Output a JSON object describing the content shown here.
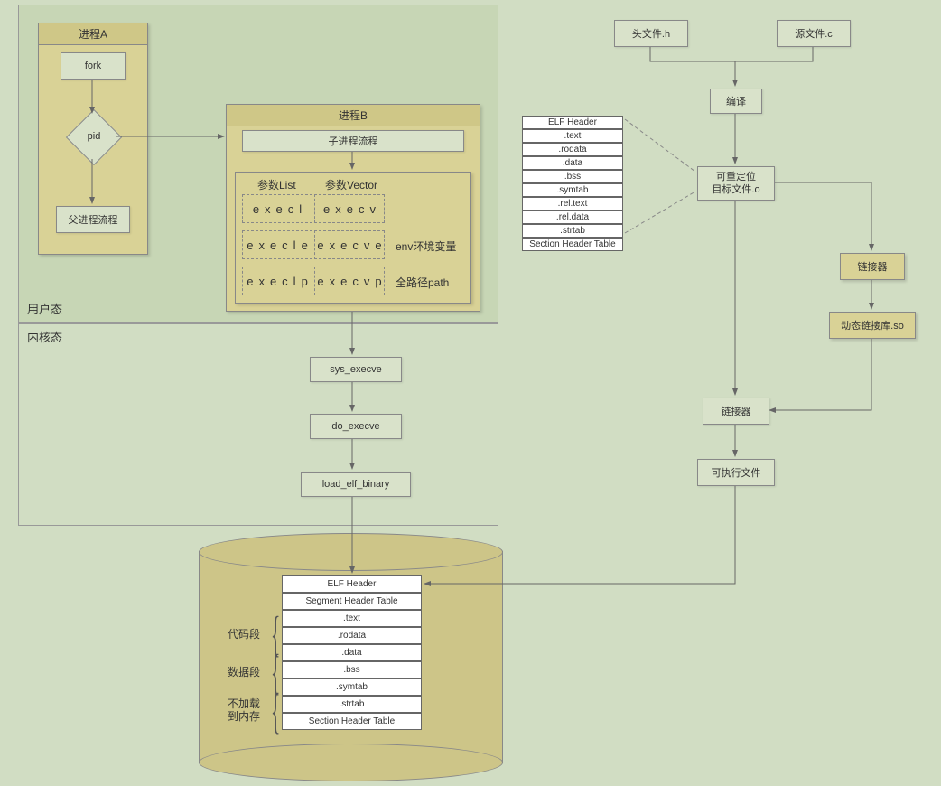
{
  "userkernel": {
    "user": "用户态",
    "kernel": "内核态"
  },
  "procA": {
    "title": "进程A",
    "fork": "fork",
    "pid": "pid",
    "parent": "父进程流程"
  },
  "procB": {
    "title": "进程B",
    "title2": "子进程流程",
    "colL": "参数List",
    "colV": "参数Vector",
    "execl": "execl",
    "execv": "execv",
    "execle": "execle",
    "execve": "execve",
    "execlp": "execlp",
    "execvp": "execvp",
    "env": "env环境变量",
    "path": "全路径path"
  },
  "kernel": {
    "sys": "sys_execve",
    "do": "do_execve",
    "load": "load_elf_binary"
  },
  "top": {
    "header": "头文件.h",
    "source": "源文件.c",
    "compile": "编译",
    "obj1": "可重定位",
    "obj2": "目标文件.o",
    "linker1": "链接器",
    "dso": "动态链接库.so",
    "linker2": "链接器",
    "exe": "可执行文件"
  },
  "elfsmall": [
    "ELF Header",
    ".text",
    ".rodata",
    ".data",
    ".bss",
    ".symtab",
    ".rel.text",
    ".rel.data",
    ".strtab",
    "Section Header Table"
  ],
  "elfbig": {
    "rows": [
      "ELF Header",
      "Segment Header Table",
      ".text",
      ".rodata",
      ".data",
      ".bss",
      ".symtab",
      ".strtab",
      "Section Header Table"
    ],
    "codeseg": "代码段",
    "dataseg": "数据段",
    "noload1": "不加载",
    "noload2": "到内存"
  }
}
